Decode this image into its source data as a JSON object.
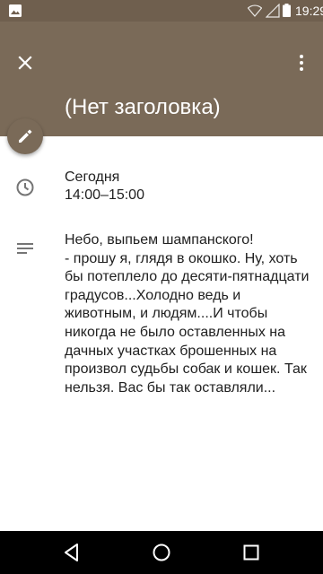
{
  "status_bar": {
    "time": "19:29",
    "icons": [
      "gallery-icon",
      "wifi-icon",
      "signal-icon",
      "battery-icon"
    ]
  },
  "header": {
    "title": "(Нет заголовка)",
    "close_icon": "close-icon",
    "more_icon": "more-vert-icon",
    "background_color": "#7a6a58"
  },
  "edit_button": {
    "icon": "pencil-icon"
  },
  "event": {
    "date": "Сегодня",
    "time_range": "14:00–15:00",
    "description": "Небо, выпьем шампанского!\n- прошу я, глядя в окошко. Ну, хоть бы потеплело до десяти-пятнадцати градусов...Холодно ведь и животным, и людям....И чтобы никогда не было оставленных на дачных участках брошенных на произвол судьбы собак и кошек. Так нельзя. Вас бы так оставляли..."
  },
  "nav_bar": {
    "buttons": [
      "back-icon",
      "home-icon",
      "recents-icon"
    ]
  }
}
